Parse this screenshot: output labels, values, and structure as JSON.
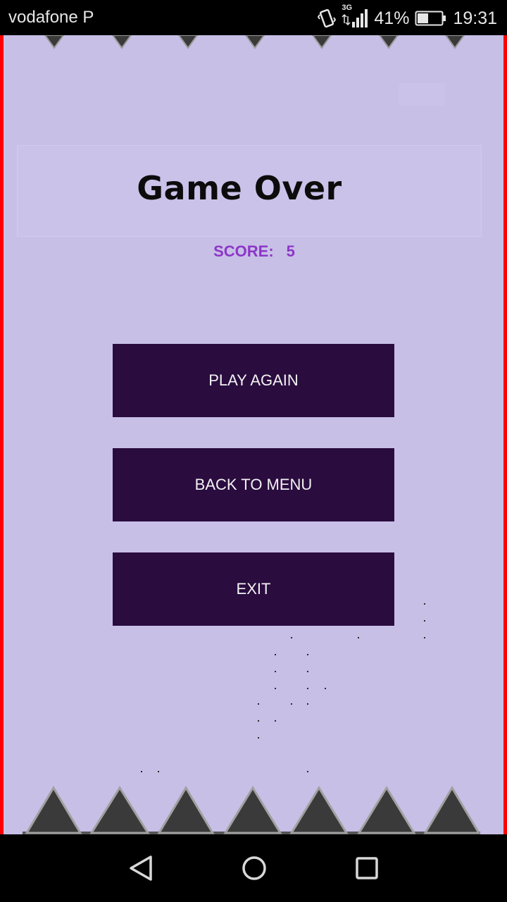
{
  "status_bar": {
    "carrier": "vodafone P",
    "network_type": "3G",
    "battery_percent": "41%",
    "time": "19:31",
    "icons": [
      "vibrate-icon",
      "signal-icon",
      "battery-icon"
    ]
  },
  "game": {
    "title": "Game Over",
    "score_label": "SCORE:",
    "score_value": "5",
    "buttons": {
      "play_again": "PLAY AGAIN",
      "back_to_menu": "BACK TO MENU",
      "exit": "EXIT"
    },
    "colors": {
      "background": "#c8bfe7",
      "walls": "#ff0000",
      "button": "#2a0c3f",
      "button_text": "#f2f2f2",
      "score_text": "#8d36c8",
      "spikes": "#3a3a3a"
    }
  },
  "nav_bar": {
    "buttons": [
      "back-icon",
      "home-icon",
      "recents-icon"
    ]
  }
}
